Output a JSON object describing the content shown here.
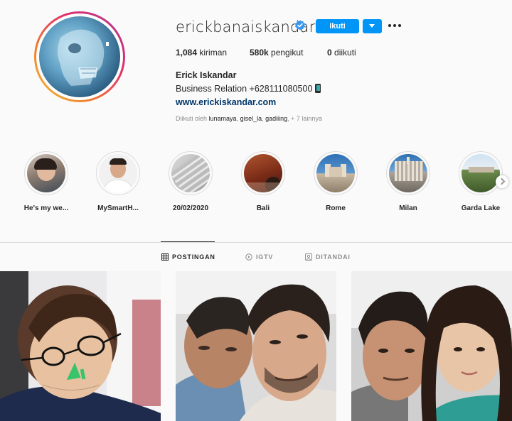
{
  "profile": {
    "username": "erickbanaiskandar",
    "verified": true,
    "follow_label": "Ikuti",
    "full_name": "Erick Iskandar",
    "bio": "Business Relation +628111080500",
    "website": "www.erickiskandar.com",
    "followed_by": {
      "prefix": "Diikuti oleh ",
      "names": [
        "lunamaya",
        "gisel_la",
        "gadiiing"
      ],
      "suffix": "+ 7 lainnya"
    }
  },
  "stats": {
    "posts_value": "1,084",
    "posts_label": " kiriman",
    "followers_value": "580k",
    "followers_label": " pengikut",
    "following_value": "0",
    "following_label": " diikuti"
  },
  "highlights": [
    {
      "label": "He's my we..."
    },
    {
      "label": "MySmartH..."
    },
    {
      "label": "20/02/2020"
    },
    {
      "label": "Bali"
    },
    {
      "label": "Rome"
    },
    {
      "label": "Milan"
    },
    {
      "label": "Garda Lake"
    }
  ],
  "tabs": [
    {
      "label": "POSTINGAN",
      "icon": "grid-icon",
      "active": true
    },
    {
      "label": "IGTV",
      "icon": "igtv-icon",
      "active": false
    },
    {
      "label": "DITANDAI",
      "icon": "tagged-icon",
      "active": false
    }
  ],
  "colors": {
    "accent": "#0095f6",
    "link": "#00376b",
    "muted": "#8e8e8e",
    "text": "#262626"
  }
}
